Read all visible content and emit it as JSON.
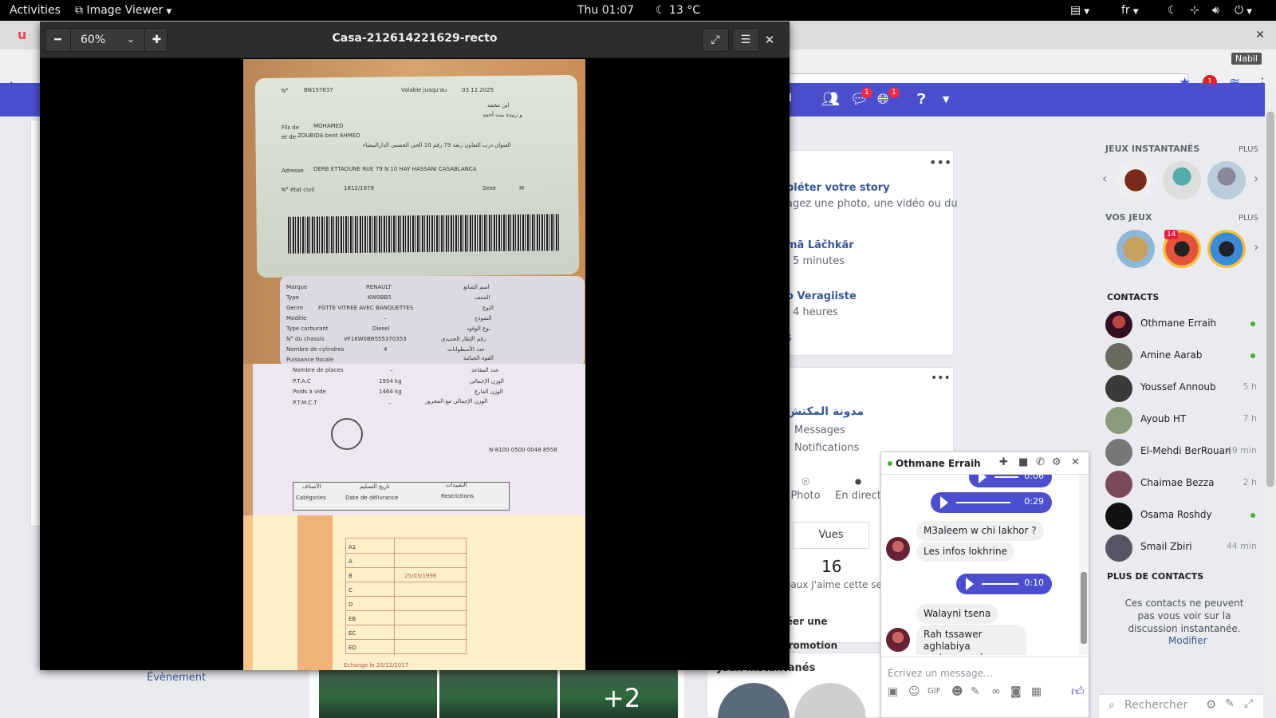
{
  "topbar": {
    "activities": "Activities",
    "app_name": "Image Viewer",
    "clock": "Thu 01:07",
    "weather": "13 °C",
    "keyboard_layout": "fr"
  },
  "browser": {
    "profile_name": "Nabil",
    "adblock_count": "1"
  },
  "fb_header": {
    "home_label": "il",
    "messages_badge": "1",
    "notifications_badge": "1"
  },
  "left": {
    "evenement": "Évènement"
  },
  "story_card": {
    "title": "pléter votre story",
    "subtitle": "agez une photo, une vidéo ou du",
    "items": [
      {
        "name": "mā Lãčhkär",
        "time": "5 minutes"
      },
      {
        "name": "o Veragiiste",
        "time": "4 heures"
      }
    ],
    "more": "s"
  },
  "page_card": {
    "name": "مدونة المكتش",
    "links": [
      "Messages",
      "Notifications"
    ],
    "actions": [
      {
        "label": "Photo",
        "icon": "camera-icon"
      },
      {
        "label": "En direct",
        "icon": "live-video-icon"
      }
    ],
    "vues_tab": "Vues",
    "likes_count": "16",
    "likes_label": "eaux J'aime cette sem",
    "promo_button": "réer une promotion"
  },
  "games_card": {
    "title": "Jeux instantanés"
  },
  "photo_strip": {
    "more": "+2"
  },
  "right_sidebar": {
    "instant_games_title": "JEUX INSTANTANÉS",
    "my_games_title": "VOS JEUX",
    "plus_label": "PLUS",
    "pool_badge": "14",
    "contacts_title": "CONTACTS",
    "contacts": [
      {
        "name": "Othmane Erraih",
        "time": "",
        "online": true
      },
      {
        "name": "Amine Aarab",
        "time": "",
        "online": true
      },
      {
        "name": "Youssef Annoub",
        "time": "5 h",
        "online": false
      },
      {
        "name": "Ayoub HT",
        "time": "7 h",
        "online": false
      },
      {
        "name": "El-Mehdi BerRouan",
        "time": "49 min",
        "online": false
      },
      {
        "name": "Chaimae Bezza",
        "time": "2 h",
        "online": false
      },
      {
        "name": "Osama Roshdy",
        "time": "",
        "online": true
      },
      {
        "name": "Smail Zbiri",
        "time": "44 min",
        "online": false
      }
    ],
    "more_contacts_title": "PLUS DE CONTACTS",
    "more_contacts_msg": "Ces contacts ne peuvent pas vous voir sur la discussion instantanée.",
    "modifier": "Modifier",
    "search_placeholder": "Rechercher"
  },
  "chat": {
    "name": "Othmane Erraih",
    "voice_durations": [
      "0:06",
      "0:29",
      "0:10"
    ],
    "messages": [
      "M3aleem w chi lakhor ?",
      "Les infos lokhrine",
      "Walayni tsena",
      "Rah tssawer aghlabiya endommagé"
    ],
    "input_placeholder": "Écrivez un message..."
  },
  "viewer": {
    "zoom": "60%",
    "title": "Casa-212614221629-recto"
  },
  "document": {
    "id_card": {
      "number_label": "N°",
      "number": "BN157637",
      "valid_label": "Valable jusqu'au",
      "valid_date": "03.12.2025",
      "father_label": "Fils de",
      "father": "MOHAMED",
      "mother_label": "et de",
      "mother": "ZOUBIDA bent AHMED",
      "address_label": "Adresse",
      "address": "DERB ETTAOUNE RUE 79 N 10 HAY HASSANI CASABLANCA",
      "civil_label": "N° état civil",
      "civil": "1812/1979",
      "sex_label": "Sexe",
      "sex": "M",
      "arabic_address": "العنوان  درب التعاون زنقة 79 رقم 10 الحي الحسني الدارالبيضاء",
      "arabic_father": "ابن محمد",
      "arabic_mother": "و زبيدة بنت أحمد"
    },
    "registration": {
      "rows": [
        {
          "label": "Marque",
          "value": "RENAULT",
          "ar": "اسم الصانع"
        },
        {
          "label": "Type",
          "value": "KW0BB5",
          "ar": "الصنف"
        },
        {
          "label": "Genre",
          "value": "FGTTE VITREE AVEC BANQUETTES",
          "ar": "النوع"
        },
        {
          "label": "Modèle",
          "value": "–",
          "ar": "النموذج"
        },
        {
          "label": "Type carburant",
          "value": "Diesel",
          "ar": "نوع الوقود"
        },
        {
          "label": "N° du chassis",
          "value": "VF1KW0BB555370353",
          "ar": "رقم الإطار الحديدي"
        },
        {
          "label": "Nombre de cylindres",
          "value": "4",
          "ar": "عدد الأسطوانات"
        },
        {
          "label": "Puissance fiscale",
          "value": "",
          "ar": "القوة الجبائية"
        }
      ],
      "rows2": [
        {
          "label": "Nombre de places",
          "value": "–",
          "ar": "عدد المقاعد"
        },
        {
          "label": "P.T.A.C",
          "value": "1954 kg",
          "ar": "الوزن الإجمالي"
        },
        {
          "label": "Poids à vide",
          "value": "1464 kg",
          "ar": "الوزن الفارغ"
        },
        {
          "label": "P.T.M.C.T",
          "value": "–",
          "ar": "الوزن الإجمالي مع المجرور"
        }
      ],
      "number": "N-8100 0500 0048 8558"
    },
    "license": {
      "categories_label": "Catégories",
      "delivery_label": "Date de délivrance",
      "restrictions_label": "Restrictions",
      "categories_ar": "الأصناف",
      "delivery_ar": "تاريخ التسليم",
      "restrictions_ar": "التقييدات",
      "rows": [
        "A1",
        "A",
        "B",
        "C",
        "D",
        "EB",
        "EC",
        "ED"
      ],
      "b_date": "25/03/1998",
      "exchange": "Echange le 20/12/2017"
    }
  }
}
